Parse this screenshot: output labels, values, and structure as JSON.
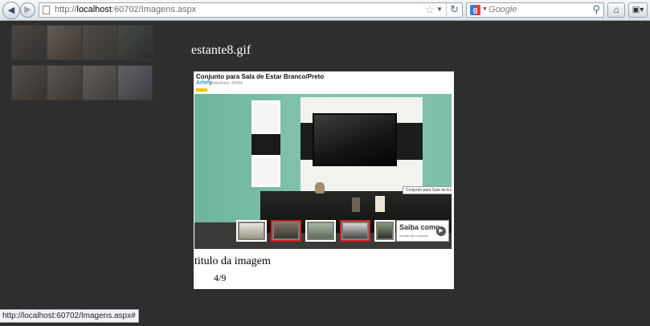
{
  "browser": {
    "url_prefix": "http://",
    "url_host": "localhost",
    "url_path": ":60702/Imagens.aspx",
    "search_placeholder": "Google",
    "status_text": "http://localhost:60702/Imagens.aspx#"
  },
  "icons": {
    "back": "back-arrow-icon",
    "forward": "forward-arrow-icon",
    "page": "page-icon",
    "bookmark": "star-icon",
    "reload": "reload-icon",
    "search_engine": "google-icon",
    "search": "magnifier-icon",
    "home": "home-icon",
    "extensions": "extension-icon"
  },
  "gallery": {
    "thumbnail_count": 8
  },
  "lightbox": {
    "filename": "estante8.gif",
    "product_title": "Conjunto para Sala de Estar Branco/Preto",
    "brand": "Artely",
    "reference": "Referência: 40444",
    "image_caption": "Conjunto para Sala de Estar",
    "saiba_title": "Saiba como",
    "saiba_subtitle": "montar seu conjunto",
    "title": "titulo da imagem",
    "counter": "4/9"
  },
  "colors": {
    "page_background": "#2e2e2e",
    "lightbox_background": "#ffffff",
    "wall": "#7fbea9",
    "selected_thumb": "#d32020"
  }
}
